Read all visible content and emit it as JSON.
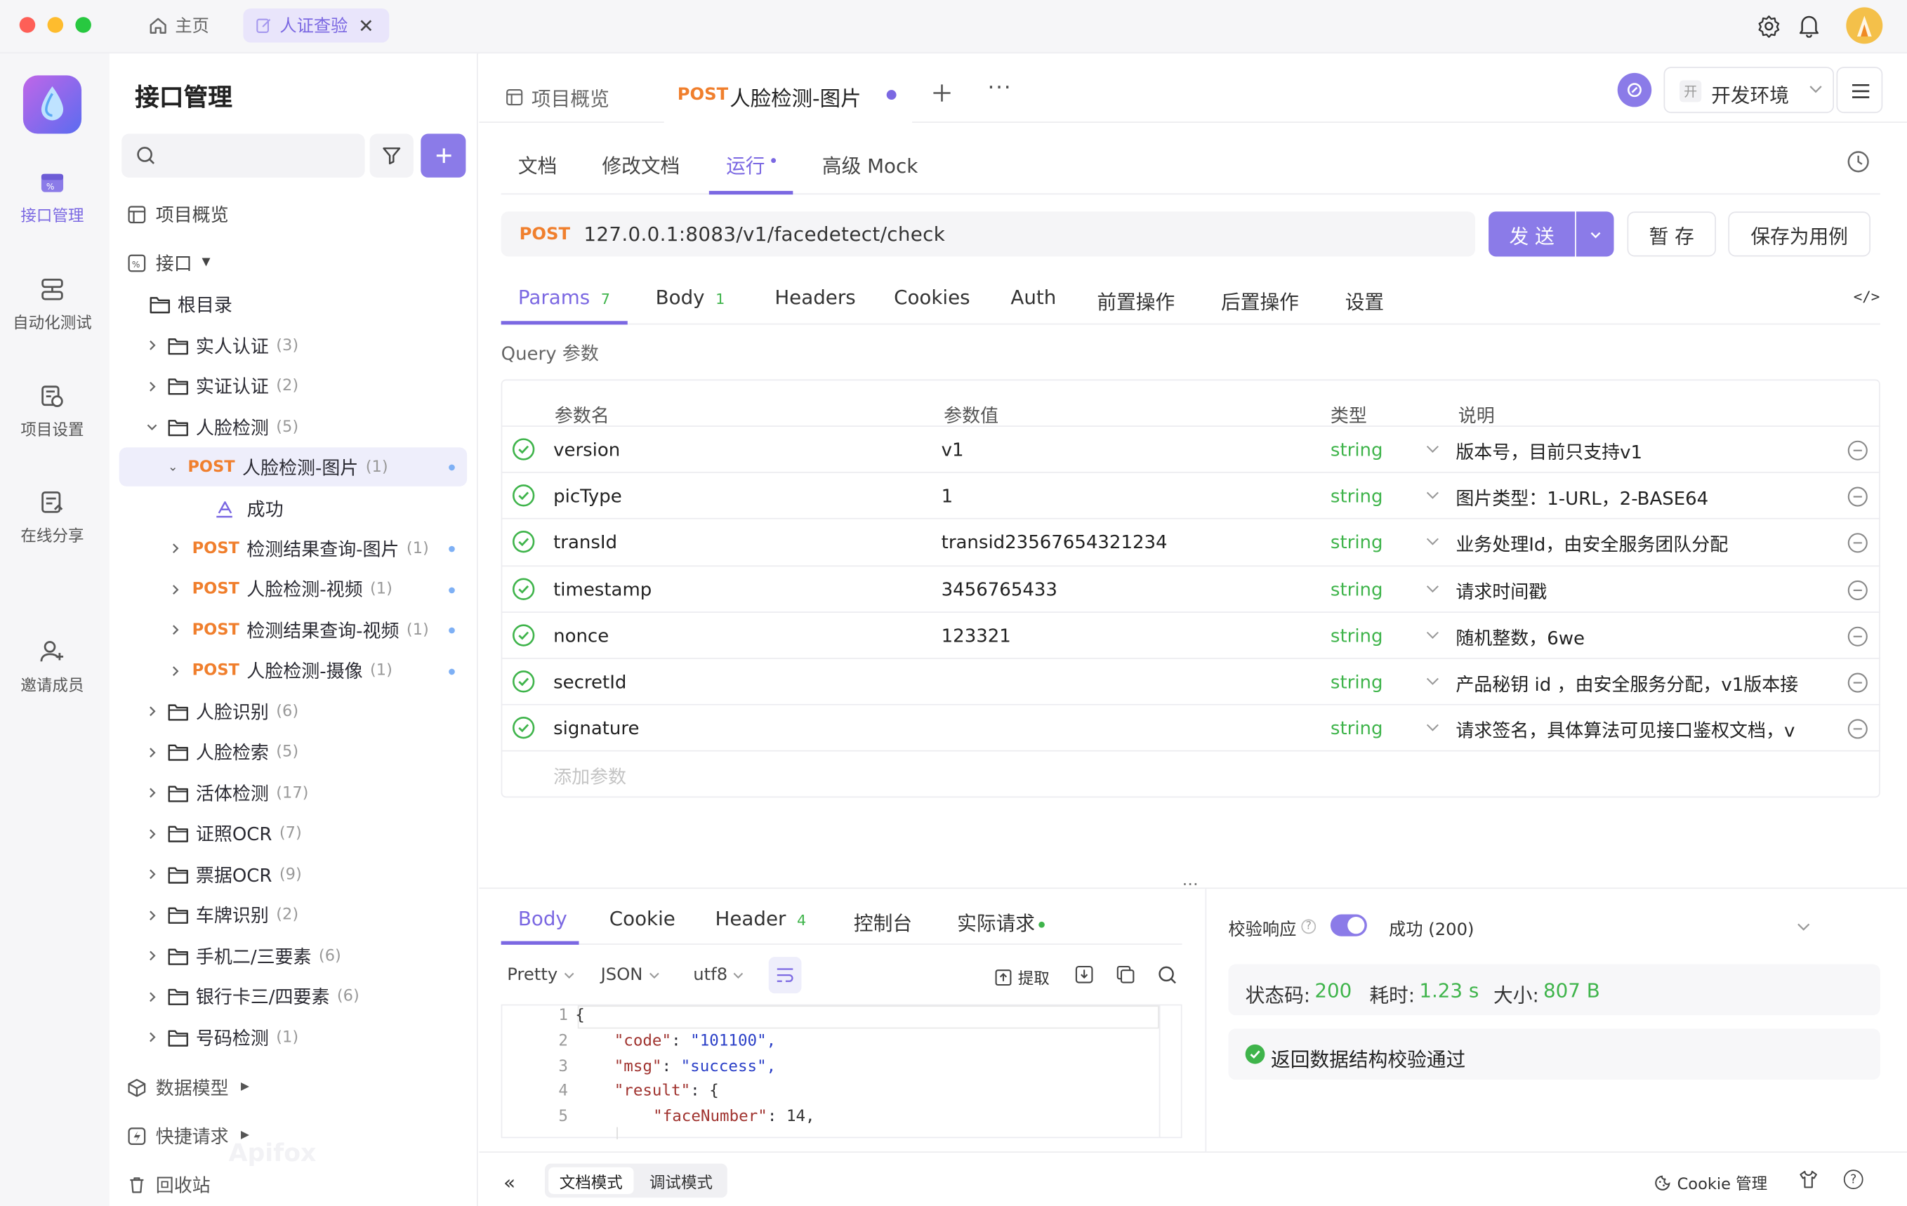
{
  "titlebar": {
    "home_label": "主页",
    "active_tab_label": "人证查验"
  },
  "rail": {
    "items": [
      {
        "label": "接口管理"
      },
      {
        "label": "自动化测试"
      },
      {
        "label": "项目设置"
      },
      {
        "label": "在线分享"
      },
      {
        "label": "邀请成员"
      }
    ]
  },
  "tree": {
    "title": "接口管理",
    "overview": "项目概览",
    "api_root": "接口",
    "root_dir": "根目录",
    "folders_top": [
      {
        "name": "实人认证",
        "count": "(3)"
      },
      {
        "name": "实证认证",
        "count": "(2)"
      },
      {
        "name": "人脸检测",
        "count": "(5)"
      }
    ],
    "selected": {
      "method": "POST",
      "name": "人脸检测-图片",
      "count": "(1)"
    },
    "case_label": "成功",
    "apis": [
      {
        "method": "POST",
        "name": "检测结果查询-图片",
        "count": "(1)"
      },
      {
        "method": "POST",
        "name": "人脸检测-视频",
        "count": "(1)"
      },
      {
        "method": "POST",
        "name": "检测结果查询-视频",
        "count": "(1)"
      },
      {
        "method": "POST",
        "name": "人脸检测-摄像",
        "count": "(1)"
      }
    ],
    "folders_bottom": [
      {
        "name": "人脸识别",
        "count": "(6)"
      },
      {
        "name": "人脸检索",
        "count": "(5)"
      },
      {
        "name": "活体检测",
        "count": "(17)"
      },
      {
        "name": "证照OCR",
        "count": "(7)"
      },
      {
        "name": "票据OCR",
        "count": "(9)"
      },
      {
        "name": "车牌识别",
        "count": "(2)"
      },
      {
        "name": "手机二/三要素",
        "count": "(6)"
      },
      {
        "name": "银行卡三/四要素",
        "count": "(6)"
      },
      {
        "name": "号码检测",
        "count": "(1)"
      }
    ],
    "data_model": "数据模型",
    "quick_request": "快捷请求",
    "recycle": "回收站",
    "watermark": "Apifox"
  },
  "main": {
    "top_tabs": {
      "overview": "项目概览",
      "active_method": "POST",
      "active_name": "人脸检测-图片"
    },
    "env": {
      "badge": "开",
      "label": "开发环境"
    },
    "sub_tabs": [
      "文档",
      "修改文档",
      "运行",
      "高级 Mock"
    ],
    "request": {
      "method": "POST",
      "url": "127.0.0.1:8083/v1/facedetect/check",
      "send": "发 送",
      "save_temp": "暂 存",
      "save_case": "保存为用例"
    },
    "param_tabs": [
      {
        "label": "Params",
        "count": "7"
      },
      {
        "label": "Body",
        "count": "1"
      },
      {
        "label": "Headers",
        "count": ""
      },
      {
        "label": "Cookies",
        "count": ""
      },
      {
        "label": "Auth",
        "count": ""
      },
      {
        "label": "前置操作",
        "count": ""
      },
      {
        "label": "后置操作",
        "count": ""
      },
      {
        "label": "设置",
        "count": ""
      }
    ],
    "query_title": "Query 参数",
    "table_headers": [
      "参数名",
      "参数值",
      "类型",
      "说明"
    ],
    "params": [
      {
        "name": "version",
        "value": "v1",
        "type": "string",
        "desc": "版本号，目前只支持v1"
      },
      {
        "name": "picType",
        "value": "1",
        "type": "string",
        "desc": "图片类型：1-URL，2-BASE64"
      },
      {
        "name": "transId",
        "value": "transid23567654321234",
        "type": "string",
        "desc": "业务处理Id，由安全服务团队分配"
      },
      {
        "name": "timestamp",
        "value": "3456765433",
        "type": "string",
        "desc": "请求时间戳"
      },
      {
        "name": "nonce",
        "value": "123321",
        "type": "string",
        "desc": "随机整数，6we"
      },
      {
        "name": "secretId",
        "value": "",
        "type": "string",
        "desc": "产品秘钥 id ，由安全服务分配，v1版本接"
      },
      {
        "name": "signature",
        "value": "",
        "type": "string",
        "desc": "请求签名，具体算法可见接口鉴权文档，v"
      }
    ],
    "add_param_placeholder": "添加参数",
    "response": {
      "tabs": [
        {
          "label": "Body",
          "count": ""
        },
        {
          "label": "Cookie",
          "count": ""
        },
        {
          "label": "Header",
          "count": "4"
        },
        {
          "label": "控制台",
          "count": ""
        },
        {
          "label": "实际请求",
          "count": ""
        }
      ],
      "format": "Pretty",
      "lang": "JSON",
      "encoding": "utf8",
      "extract": "提取",
      "code_lines": [
        {
          "num": "1",
          "text": "{"
        },
        {
          "num": "2",
          "key": "\"code\"",
          "val": "\"101100\","
        },
        {
          "num": "3",
          "key": "\"msg\"",
          "val": "\"success\","
        },
        {
          "num": "4",
          "key": "\"result\"",
          "val": "{"
        },
        {
          "num": "5",
          "key": "\"faceNumber\"",
          "val": "14,"
        }
      ]
    },
    "validation": {
      "label": "校验响应",
      "status": "成功 (200)",
      "status_code_label": "状态码:",
      "status_code": "200",
      "time_label": "耗时:",
      "time": "1.23 s",
      "size_label": "大小:",
      "size": "807 B",
      "message": "返回数据结构校验通过"
    },
    "footer": {
      "doc_mode": "文档模式",
      "debug_mode": "调试模式",
      "cookie_manage": "Cookie 管理"
    }
  },
  "colors": {
    "accent": "#7b68e2",
    "post": "#f07f2d",
    "success": "#3fb44b"
  }
}
